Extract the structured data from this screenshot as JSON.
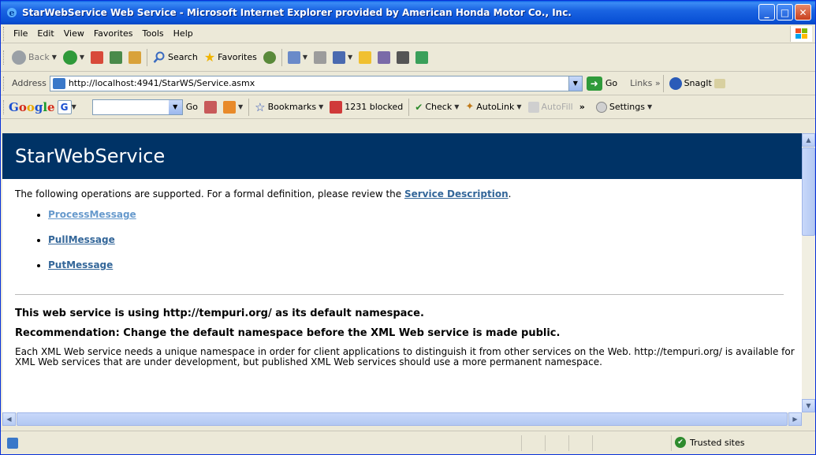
{
  "window": {
    "title": "StarWebService Web Service - Microsoft Internet Explorer provided by American Honda Motor Co., Inc."
  },
  "menu": [
    {
      "label": "File"
    },
    {
      "label": "Edit"
    },
    {
      "label": "View"
    },
    {
      "label": "Favorites"
    },
    {
      "label": "Tools"
    },
    {
      "label": "Help"
    }
  ],
  "toolbar": {
    "back": "Back",
    "search": "Search",
    "favorites": "Favorites"
  },
  "address": {
    "label": "Address",
    "url": "http://localhost:4941/StarWS/Service.asmx",
    "go": "Go",
    "links": "Links",
    "snagit": "SnagIt"
  },
  "google": {
    "go": "Go",
    "bookmarks": "Bookmarks",
    "blocked": "1231 blocked",
    "check": "Check",
    "autolink": "AutoLink",
    "autofill": "AutoFill",
    "settings": "Settings"
  },
  "page": {
    "heading": "StarWebService",
    "intro_text": "The following operations are supported. For a formal definition, please review the ",
    "service_description": "Service Description",
    "intro_end": ".",
    "operations": [
      {
        "label": "ProcessMessage"
      },
      {
        "label": "PullMessage"
      },
      {
        "label": "PutMessage"
      }
    ],
    "ns_heading": "This web service is using http://tempuri.org/ as its default namespace.",
    "recommendation": "Recommendation: Change the default namespace before the XML Web service is made public.",
    "explanation": "Each XML Web service needs a unique namespace in order for client applications to distinguish it from other services on the Web. http://tempuri.org/ is available for XML Web services that are under development, but published XML Web services should use a more permanent namespace."
  },
  "status": {
    "zone": "Trusted sites"
  }
}
